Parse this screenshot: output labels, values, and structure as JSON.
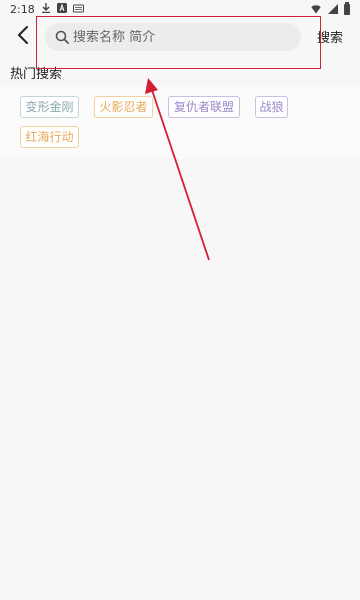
{
  "status_bar": {
    "time": "2:18"
  },
  "header": {
    "back_icon": "chevron-left-icon",
    "search": {
      "placeholder": "搜索名称 简介",
      "icon": "search-icon"
    },
    "search_button_label": "搜索"
  },
  "hot_search": {
    "title": "热门搜索",
    "tags": [
      {
        "label": "变形金刚",
        "color": "#88a9b0"
      },
      {
        "label": "火影忍者",
        "color": "#e7a85a"
      },
      {
        "label": "复仇者联盟",
        "color": "#9a88c9"
      },
      {
        "label": "战狼",
        "color": "#9a88c9"
      },
      {
        "label": "红海行动",
        "color": "#e7a85a"
      }
    ]
  },
  "annotation": {
    "color": "#d11f35"
  }
}
